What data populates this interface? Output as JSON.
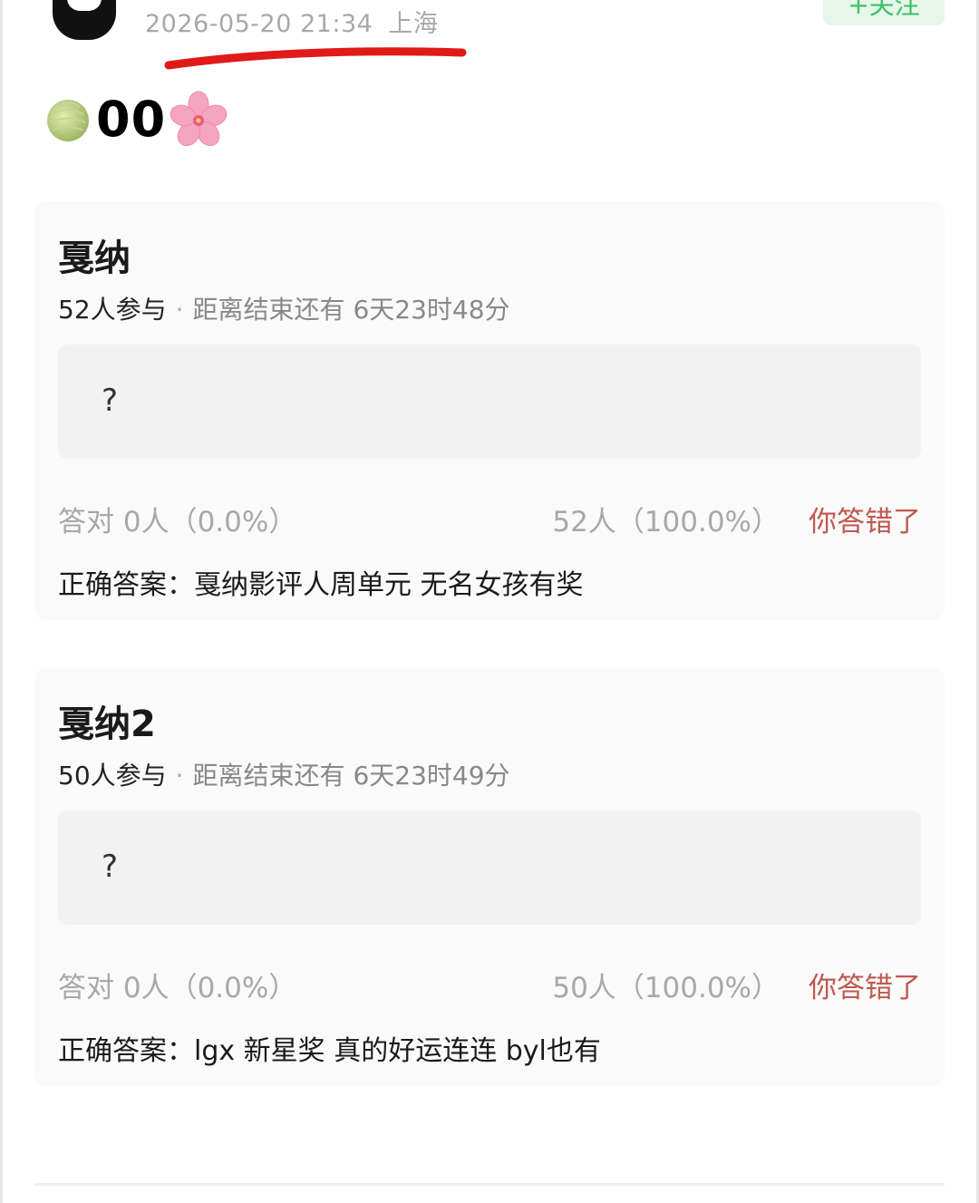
{
  "post": {
    "timestamp": "2026-05-20 21:34",
    "location": "上海",
    "follow_label": "+关注",
    "title": "00",
    "title_icons": [
      "melon-icon",
      "cherry-blossom-icon"
    ]
  },
  "quizzes": [
    {
      "title": "戛纳",
      "participants": "52人参与",
      "separator": "·",
      "time_remaining": "距离结束还有 6天23时48分",
      "question": "?",
      "correct_stats": "答对 0人（0.0%）",
      "wrong_stats": "52人（100.0%）",
      "result_label": "你答错了",
      "answer": "正确答案：戛纳影评人周单元 无名女孩有奖"
    },
    {
      "title": "戛纳2",
      "participants": "50人参与",
      "separator": "·",
      "time_remaining": "距离结束还有 6天23时49分",
      "question": "?",
      "correct_stats": "答对 0人（0.0%）",
      "wrong_stats": "50人（100.0%）",
      "result_label": "你答错了",
      "answer": "正确答案：lgx 新星奖 真的好运连连 byl也有"
    }
  ],
  "colors": {
    "follow_bg": "#e6f6e9",
    "follow_text": "#3fbf6b",
    "wrong_text": "#c0584f",
    "annotation_red": "#e01919"
  }
}
